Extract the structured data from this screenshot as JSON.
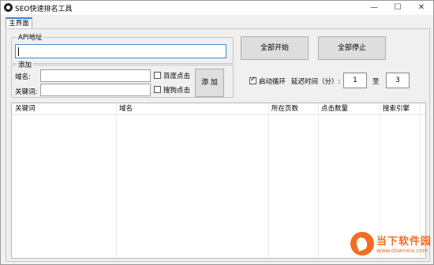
{
  "window": {
    "title": "SEO快速排名工具",
    "minimize_glyph": "—",
    "maximize_glyph": "☐",
    "close_glyph": "✕"
  },
  "tabs": [
    {
      "label": "主界面",
      "active": true
    }
  ],
  "api": {
    "legend": "API地址",
    "value": ""
  },
  "add": {
    "legend": "添加",
    "domain_label": "域名:",
    "keyword_label": "关键词:",
    "baidu_label": "百度点击",
    "sogou_label": "搜狗点击",
    "add_button": "添 加",
    "baidu_checked": false,
    "sogou_checked": false
  },
  "controls": {
    "start_all": "全部开始",
    "stop_all": "全部停止",
    "loop_label": "启动循环",
    "loop_checked": true,
    "delay_label": "延迟时间（分）:",
    "delay_min": "1",
    "to_label": "至",
    "delay_max": "3"
  },
  "table": {
    "columns": [
      "关键词",
      "域名",
      "所在页数",
      "点击数量",
      "搜索引擎"
    ],
    "rows": []
  },
  "watermark": {
    "text": "当下软件园",
    "url": "www.downxia.com",
    "color": "#f26d22"
  },
  "colors": {
    "accent": "#3c8fd6",
    "background": "#f0f0f0"
  }
}
